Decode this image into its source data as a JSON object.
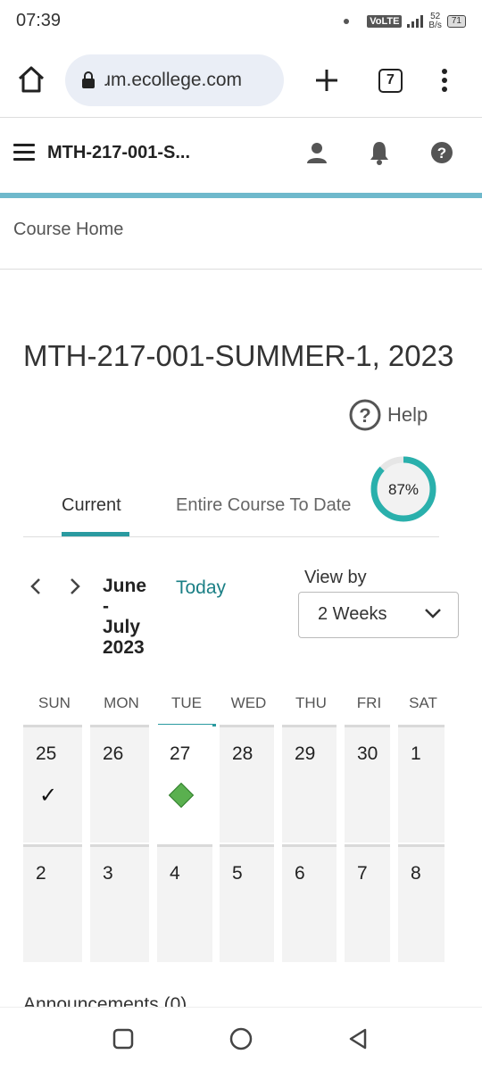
{
  "status_bar": {
    "time": "07:39",
    "volte": "VoLTE",
    "net_speed_value": "52",
    "net_speed_unit": "B/s",
    "battery": "71"
  },
  "browser": {
    "url": "ɹm.ecollege.com",
    "tab_count": "7"
  },
  "header": {
    "course_code": "MTH-217-001-S..."
  },
  "breadcrumb": "Course Home",
  "page": {
    "title": "MTH-217-001-SUMMER-1, 2023",
    "help_label": "Help"
  },
  "tabs": {
    "current": "Current",
    "entire": "Entire Course To Date",
    "progress_label": "87%",
    "progress_value": 87
  },
  "calendar_nav": {
    "range_line1": "June",
    "range_line2": "-",
    "range_line3": "July",
    "range_line4": "2023",
    "today_label": "Today",
    "view_by_label": "View by",
    "view_by_value": "2 Weeks"
  },
  "calendar": {
    "days_of_week": [
      "SUN",
      "MON",
      "TUE",
      "WED",
      "THU",
      "FRI",
      "SAT"
    ],
    "week1": [
      "25",
      "26",
      "27",
      "28",
      "29",
      "30",
      "1"
    ],
    "week2": [
      "2",
      "3",
      "4",
      "5",
      "6",
      "7",
      "8"
    ],
    "completed_day": "25",
    "due_day": "27",
    "today_day": "27"
  },
  "announcements_label": "Announcements (0)",
  "colors": {
    "accent": "#2a9aa0",
    "header_bar": "#6fb9cc",
    "due_marker": "#5ab04f"
  }
}
